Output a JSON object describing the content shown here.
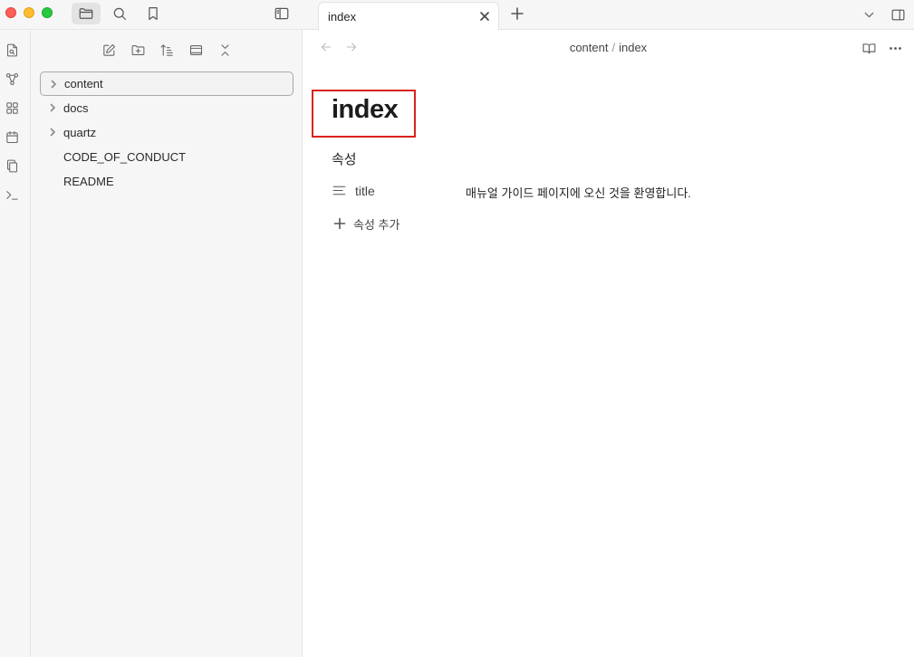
{
  "window": {
    "active_left_tab": "files"
  },
  "explorer": {
    "items": [
      {
        "label": "content",
        "type": "folder",
        "selected": true
      },
      {
        "label": "docs",
        "type": "folder"
      },
      {
        "label": "quartz",
        "type": "folder"
      },
      {
        "label": "CODE_OF_CONDUCT",
        "type": "file"
      },
      {
        "label": "README",
        "type": "file"
      }
    ]
  },
  "tabs": [
    {
      "label": "index"
    }
  ],
  "breadcrumb": {
    "folder": "content",
    "separator": "/",
    "file": "index"
  },
  "note": {
    "title": "index",
    "properties_heading": "속성",
    "properties": [
      {
        "key": "title",
        "value": "매뉴얼 가이드 페이지에 오신 것을 환영합니다.",
        "icon": "text-lines-icon"
      }
    ],
    "add_property_label": "속성 추가"
  },
  "colors": {
    "highlight_box": "#d9221c",
    "sidebar_bg": "#f6f6f6"
  }
}
